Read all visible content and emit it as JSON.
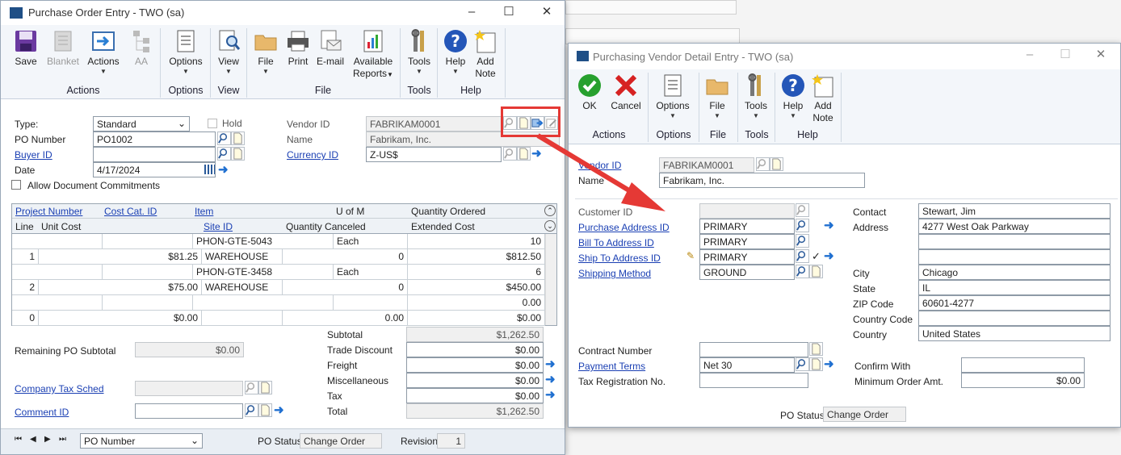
{
  "po_window": {
    "title": "Purchase Order Entry  -  TWO (sa)",
    "ribbon": {
      "buttons": [
        {
          "key": "save",
          "label": "Save"
        },
        {
          "key": "blanket",
          "label": "Blanket"
        },
        {
          "key": "actions",
          "label": "Actions"
        },
        {
          "key": "aa",
          "label": "AA"
        },
        {
          "key": "options",
          "label": "Options"
        },
        {
          "key": "view",
          "label": "View"
        },
        {
          "key": "file",
          "label": "File"
        },
        {
          "key": "print",
          "label": "Print"
        },
        {
          "key": "email",
          "label": "E-mail"
        },
        {
          "key": "available_reports",
          "label": "Available Reports"
        },
        {
          "key": "tools",
          "label": "Tools"
        },
        {
          "key": "help",
          "label": "Help"
        },
        {
          "key": "add_note",
          "label": "Add Note"
        }
      ],
      "groups": [
        "Actions",
        "Options",
        "View",
        "File",
        "Tools",
        "Help"
      ]
    },
    "type_label": "Type:",
    "type_value": "Standard",
    "hold_label": "Hold",
    "po_number_label": "PO Number",
    "po_number_value": "PO1002",
    "buyer_id_label": "Buyer ID",
    "buyer_id_value": "",
    "date_label": "Date",
    "date_value": "4/17/2024",
    "allow_commitments_label": "Allow Document Commitments",
    "vendor_id_label": "Vendor ID",
    "vendor_id_value": "FABRIKAM0001",
    "name_label": "Name",
    "name_value": "Fabrikam, Inc.",
    "currency_id_label": "Currency ID",
    "currency_id_value": "Z-US$",
    "grid": {
      "h1": [
        "Project Number",
        "Cost Cat. ID",
        "Item",
        "U of M",
        "Quantity Ordered"
      ],
      "h2": [
        "Line",
        "Unit Cost",
        "Site ID",
        "Quantity Canceled",
        "Extended Cost"
      ],
      "rows": [
        {
          "a": [
            "",
            "",
            "PHON-GTE-5043",
            "Each",
            "10"
          ],
          "b": [
            "1",
            "$81.25",
            "WAREHOUSE",
            "0",
            "$812.50"
          ]
        },
        {
          "a": [
            "",
            "",
            "PHON-GTE-3458",
            "Each",
            "6"
          ],
          "b": [
            "2",
            "$75.00",
            "WAREHOUSE",
            "0",
            "$450.00"
          ]
        },
        {
          "a": [
            "",
            "",
            "",
            "",
            "0.00"
          ],
          "b": [
            "0",
            "$0.00",
            "",
            "0.00",
            "$0.00"
          ]
        }
      ]
    },
    "remaining_label": "Remaining PO Subtotal",
    "remaining_value": "$0.00",
    "company_tax_label": "Company Tax Sched",
    "comment_id_label": "Comment ID",
    "totals": [
      {
        "label": "Subtotal",
        "value": "$1,262.50"
      },
      {
        "label": "Trade Discount",
        "value": "$0.00"
      },
      {
        "label": "Freight",
        "value": "$0.00"
      },
      {
        "label": "Miscellaneous",
        "value": "$0.00"
      },
      {
        "label": "Tax",
        "value": "$0.00"
      },
      {
        "label": "Total",
        "value": "$1,262.50"
      }
    ],
    "status": {
      "sort_value": "PO Number",
      "po_status_label": "PO Status",
      "po_status_value": "Change Order",
      "revision_label": "Revision",
      "revision_value": "1"
    }
  },
  "vd_window": {
    "title": "Purchasing Vendor Detail Entry  -  TWO (sa)",
    "ribbon": {
      "buttons": [
        {
          "key": "ok",
          "label": "OK"
        },
        {
          "key": "cancel",
          "label": "Cancel"
        },
        {
          "key": "options",
          "label": "Options"
        },
        {
          "key": "file",
          "label": "File"
        },
        {
          "key": "tools",
          "label": "Tools"
        },
        {
          "key": "help",
          "label": "Help"
        },
        {
          "key": "add_note",
          "label": "Add Note"
        }
      ],
      "groups": [
        "Actions",
        "Options",
        "File",
        "Tools",
        "Help"
      ]
    },
    "vendor_id_label": "Vendor ID",
    "vendor_id_value": "FABRIKAM0001",
    "name_label": "Name",
    "name_value": "Fabrikam, Inc.",
    "customer_id_label": "Customer ID",
    "customer_id_value": "",
    "purchase_address_label": "Purchase Address ID",
    "purchase_address_value": "PRIMARY",
    "bill_to_label": "Bill To Address ID",
    "bill_to_value": "PRIMARY",
    "ship_to_label": "Ship To Address ID",
    "ship_to_value": "PRIMARY",
    "shipping_method_label": "Shipping Method",
    "shipping_method_value": "GROUND",
    "contact_label": "Contact",
    "contact_value": "Stewart, Jim",
    "address_label": "Address",
    "address_lines": [
      "4277 West Oak Parkway",
      "",
      ""
    ],
    "city_label": "City",
    "city_value": "Chicago",
    "state_label": "State",
    "state_value": "IL",
    "zip_label": "ZIP Code",
    "zip_value": "60601-4277",
    "country_code_label": "Country Code",
    "country_code_value": "",
    "country_label": "Country",
    "country_value": "United States",
    "contract_number_label": "Contract Number",
    "contract_number_value": "",
    "payment_terms_label": "Payment Terms",
    "payment_terms_value": "Net 30",
    "tax_reg_label": "Tax Registration No.",
    "tax_reg_value": "",
    "confirm_with_label": "Confirm With",
    "confirm_with_value": "",
    "min_order_label": "Minimum Order Amt.",
    "min_order_value": "$0.00",
    "po_status_label": "PO Status",
    "po_status_value": "Change Order"
  },
  "colors": {
    "highlight": "#e53935",
    "arrow": "#e53935",
    "link": "#1a3fb3",
    "ribbon_bg": "#f3f6fa"
  }
}
